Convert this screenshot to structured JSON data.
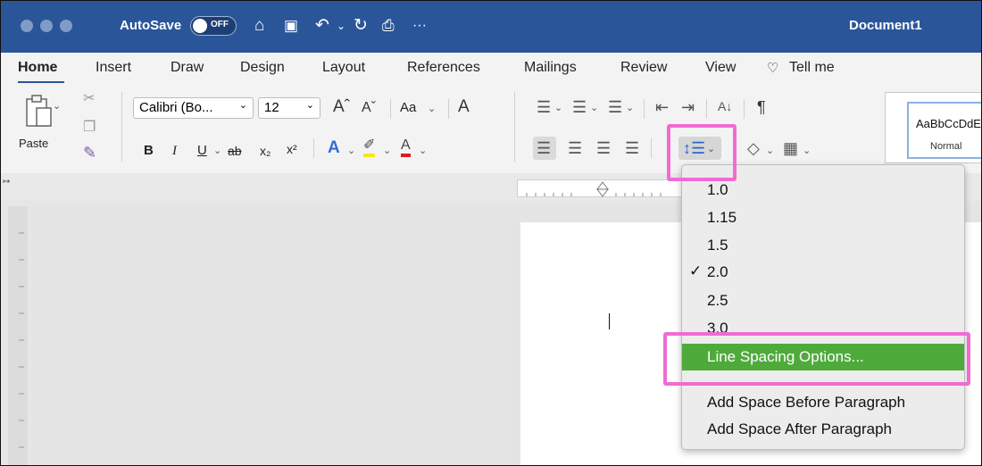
{
  "titlebar": {
    "autosave_label": "AutoSave",
    "autosave_state": "OFF",
    "doc_title": "Document1",
    "more": "···"
  },
  "tabs": [
    "Home",
    "Insert",
    "Draw",
    "Design",
    "Layout",
    "References",
    "Mailings",
    "Review",
    "View",
    "Tell me"
  ],
  "ribbon": {
    "paste_label": "Paste",
    "font_name": "Calibri (Bo...",
    "font_size": "12",
    "change_case": "Aa",
    "style_preview": "AaBbCcDdE",
    "style_name": "Normal"
  },
  "menu": {
    "items": [
      "1.0",
      "1.15",
      "1.5",
      "2.0",
      "2.5",
      "3.0"
    ],
    "checked": "✓",
    "options": "Line Spacing Options...",
    "add_before": "Add Space Before Paragraph",
    "add_after": "Add Space After Paragraph"
  },
  "colors": {
    "titlebar": "#2a5699",
    "highlight": "#f06bd2",
    "menu_selected": "#4faa3c"
  }
}
